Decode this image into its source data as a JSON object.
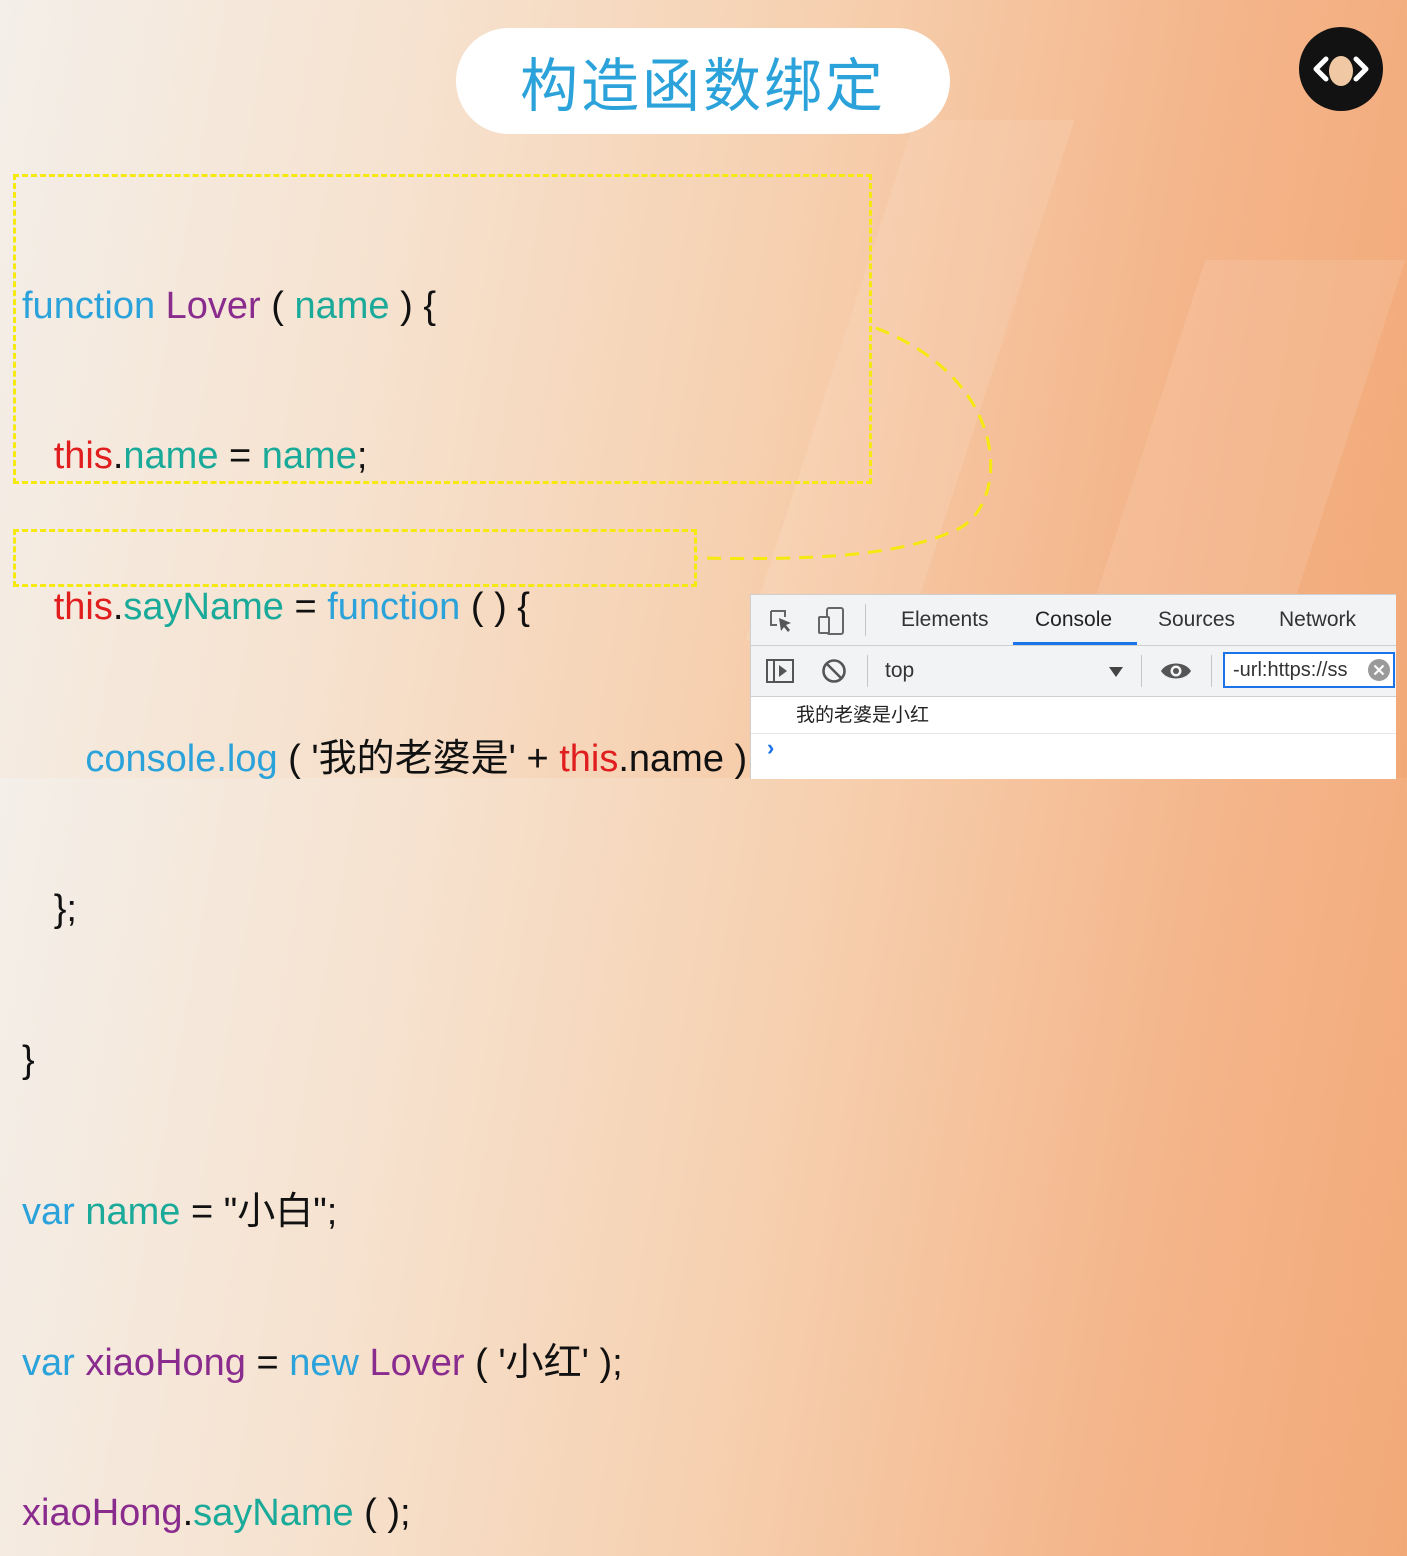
{
  "slide": {
    "title": "构造函数绑定"
  },
  "code": {
    "line1": {
      "t1": "function",
      "t2": "Lover",
      "t3": " ( ",
      "t4": "name",
      "t5": " ) {"
    },
    "line2": {
      "t1": "this",
      "t2": ".",
      "t3": "name",
      "t4": " = ",
      "t5": "name",
      "t6": ";"
    },
    "line3": {
      "t1": "this",
      "t2": ".",
      "t3": "sayName",
      "t4": " = ",
      "t5": "function",
      "t6": " ( ) {"
    },
    "line4": {
      "t1": "console.log",
      "t2": " ( '",
      "t3": "我的老婆是",
      "t4": "' + ",
      "t5": "this",
      "t6": ".name );"
    },
    "line5": {
      "t1": "};"
    },
    "line6": {
      "t1": "}"
    },
    "line7": {
      "t1": "var",
      "t2": " ",
      "t3": "name",
      "t4": " = \"",
      "t5": "小白",
      "t6": "\";"
    },
    "line8": {
      "t1": "var",
      "t2": " ",
      "t3": "xiaoHong",
      "t4": " = ",
      "t5": "new",
      "t6": " ",
      "t7": "Lover",
      "t8": " ( '",
      "t9": "小红",
      "t10": "' );"
    },
    "line9": {
      "t1": "xiaoHong",
      "t2": ".",
      "t3": "sayName",
      "t4": " ( );"
    }
  },
  "devtools": {
    "tabs": [
      "Elements",
      "Console",
      "Sources",
      "Network"
    ],
    "active_tab": "Console",
    "context": "top",
    "filter_value": "-url:https://ss",
    "log_output": "我的老婆是小红",
    "prompt_symbol": "›"
  },
  "colors": {
    "keyword": "#2ba3da",
    "class_name": "#8a2b8e",
    "this_keyword": "#e01e1e",
    "identifier": "#1aaa9a",
    "highlight_box": "#f5e90f"
  },
  "icons": [
    "logo-egg-icon",
    "inspect-element-icon",
    "device-toggle-icon",
    "sidebar-toggle-icon",
    "clear-console-icon",
    "dropdown-arrow-icon",
    "eye-icon",
    "clear-filter-icon"
  ]
}
